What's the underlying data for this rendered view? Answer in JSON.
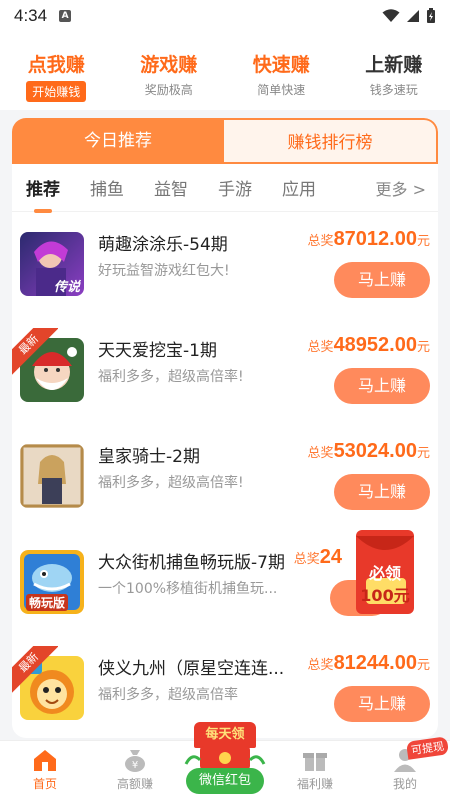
{
  "status": {
    "time": "4:34",
    "notif": "A"
  },
  "top_categories": [
    {
      "title": "点我赚",
      "sub": "开始赚钱"
    },
    {
      "title": "游戏赚",
      "sub": "奖励极高"
    },
    {
      "title": "快速赚",
      "sub": "简单快速"
    },
    {
      "title": "上新赚",
      "sub": "钱多速玩"
    }
  ],
  "tabs": {
    "active": "今日推荐",
    "other": "赚钱排行榜"
  },
  "subtabs": [
    "推荐",
    "捕鱼",
    "益智",
    "手游",
    "应用"
  ],
  "more_label": "更多 >",
  "prize_label": "总奖",
  "prize_unit": "元",
  "items": [
    {
      "title": "萌趣涂涂乐-54期",
      "desc": "好玩益智游戏红包大!",
      "amount": "87012.00",
      "button": "马上赚",
      "badge": "",
      "thumb_text": "传说"
    },
    {
      "title": "天天爱挖宝-1期",
      "desc": "福利多多，超级高倍率!",
      "amount": "48952.00",
      "button": "马上赚",
      "badge": "最新",
      "thumb_text": ""
    },
    {
      "title": "皇家骑士-2期",
      "desc": "福利多多，超级高倍率!",
      "amount": "53024.00",
      "button": "马上赚",
      "badge": "",
      "thumb_text": ""
    },
    {
      "title": "大众街机捕鱼畅玩版-7期",
      "desc": "一个100%移植街机捕鱼玩...",
      "amount": "24",
      "button": "",
      "badge": "",
      "thumb_text": "畅玩版"
    },
    {
      "title": "侠义九州（原星空连连...",
      "desc": "福利多多，超级高倍率",
      "amount": "81244.00",
      "button": "马上赚",
      "badge": "最新",
      "thumb_text": ""
    }
  ],
  "float_packet": {
    "line1": "必领",
    "line2": "100元"
  },
  "bottom_nav": [
    {
      "label": "首页",
      "icon": "home-icon"
    },
    {
      "label": "高额赚",
      "icon": "money-bag-icon"
    },
    {
      "label": "",
      "icon": ""
    },
    {
      "label": "福利赚",
      "icon": "gift-icon"
    },
    {
      "label": "我的",
      "icon": "user-icon"
    }
  ],
  "center_packet": {
    "head": "每天领",
    "label": "微信红包"
  },
  "withdraw_badge": "可提现",
  "colors": {
    "accent": "#ff6a1a",
    "button": "#ff8a5c",
    "green": "#3bb54a",
    "red": "#e8392a"
  }
}
